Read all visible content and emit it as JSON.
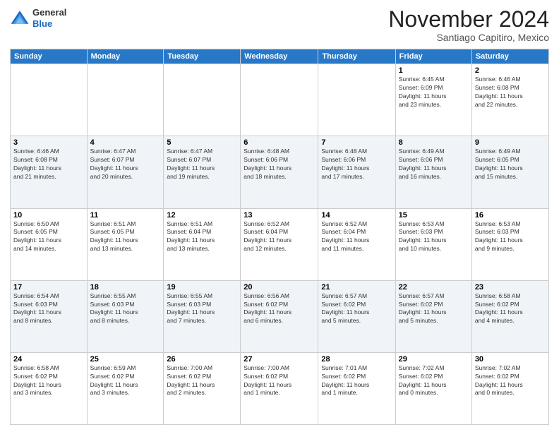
{
  "header": {
    "logo": {
      "line1": "General",
      "line2": "Blue"
    },
    "title": "November 2024",
    "location": "Santiago Capitiro, Mexico"
  },
  "days_of_week": [
    "Sunday",
    "Monday",
    "Tuesday",
    "Wednesday",
    "Thursday",
    "Friday",
    "Saturday"
  ],
  "weeks": [
    [
      {
        "day": "",
        "info": ""
      },
      {
        "day": "",
        "info": ""
      },
      {
        "day": "",
        "info": ""
      },
      {
        "day": "",
        "info": ""
      },
      {
        "day": "",
        "info": ""
      },
      {
        "day": "1",
        "info": "Sunrise: 6:45 AM\nSunset: 6:09 PM\nDaylight: 11 hours\nand 23 minutes."
      },
      {
        "day": "2",
        "info": "Sunrise: 6:46 AM\nSunset: 6:08 PM\nDaylight: 11 hours\nand 22 minutes."
      }
    ],
    [
      {
        "day": "3",
        "info": "Sunrise: 6:46 AM\nSunset: 6:08 PM\nDaylight: 11 hours\nand 21 minutes."
      },
      {
        "day": "4",
        "info": "Sunrise: 6:47 AM\nSunset: 6:07 PM\nDaylight: 11 hours\nand 20 minutes."
      },
      {
        "day": "5",
        "info": "Sunrise: 6:47 AM\nSunset: 6:07 PM\nDaylight: 11 hours\nand 19 minutes."
      },
      {
        "day": "6",
        "info": "Sunrise: 6:48 AM\nSunset: 6:06 PM\nDaylight: 11 hours\nand 18 minutes."
      },
      {
        "day": "7",
        "info": "Sunrise: 6:48 AM\nSunset: 6:06 PM\nDaylight: 11 hours\nand 17 minutes."
      },
      {
        "day": "8",
        "info": "Sunrise: 6:49 AM\nSunset: 6:06 PM\nDaylight: 11 hours\nand 16 minutes."
      },
      {
        "day": "9",
        "info": "Sunrise: 6:49 AM\nSunset: 6:05 PM\nDaylight: 11 hours\nand 15 minutes."
      }
    ],
    [
      {
        "day": "10",
        "info": "Sunrise: 6:50 AM\nSunset: 6:05 PM\nDaylight: 11 hours\nand 14 minutes."
      },
      {
        "day": "11",
        "info": "Sunrise: 6:51 AM\nSunset: 6:05 PM\nDaylight: 11 hours\nand 13 minutes."
      },
      {
        "day": "12",
        "info": "Sunrise: 6:51 AM\nSunset: 6:04 PM\nDaylight: 11 hours\nand 13 minutes."
      },
      {
        "day": "13",
        "info": "Sunrise: 6:52 AM\nSunset: 6:04 PM\nDaylight: 11 hours\nand 12 minutes."
      },
      {
        "day": "14",
        "info": "Sunrise: 6:52 AM\nSunset: 6:04 PM\nDaylight: 11 hours\nand 11 minutes."
      },
      {
        "day": "15",
        "info": "Sunrise: 6:53 AM\nSunset: 6:03 PM\nDaylight: 11 hours\nand 10 minutes."
      },
      {
        "day": "16",
        "info": "Sunrise: 6:53 AM\nSunset: 6:03 PM\nDaylight: 11 hours\nand 9 minutes."
      }
    ],
    [
      {
        "day": "17",
        "info": "Sunrise: 6:54 AM\nSunset: 6:03 PM\nDaylight: 11 hours\nand 8 minutes."
      },
      {
        "day": "18",
        "info": "Sunrise: 6:55 AM\nSunset: 6:03 PM\nDaylight: 11 hours\nand 8 minutes."
      },
      {
        "day": "19",
        "info": "Sunrise: 6:55 AM\nSunset: 6:03 PM\nDaylight: 11 hours\nand 7 minutes."
      },
      {
        "day": "20",
        "info": "Sunrise: 6:56 AM\nSunset: 6:02 PM\nDaylight: 11 hours\nand 6 minutes."
      },
      {
        "day": "21",
        "info": "Sunrise: 6:57 AM\nSunset: 6:02 PM\nDaylight: 11 hours\nand 5 minutes."
      },
      {
        "day": "22",
        "info": "Sunrise: 6:57 AM\nSunset: 6:02 PM\nDaylight: 11 hours\nand 5 minutes."
      },
      {
        "day": "23",
        "info": "Sunrise: 6:58 AM\nSunset: 6:02 PM\nDaylight: 11 hours\nand 4 minutes."
      }
    ],
    [
      {
        "day": "24",
        "info": "Sunrise: 6:58 AM\nSunset: 6:02 PM\nDaylight: 11 hours\nand 3 minutes."
      },
      {
        "day": "25",
        "info": "Sunrise: 6:59 AM\nSunset: 6:02 PM\nDaylight: 11 hours\nand 3 minutes."
      },
      {
        "day": "26",
        "info": "Sunrise: 7:00 AM\nSunset: 6:02 PM\nDaylight: 11 hours\nand 2 minutes."
      },
      {
        "day": "27",
        "info": "Sunrise: 7:00 AM\nSunset: 6:02 PM\nDaylight: 11 hours\nand 1 minute."
      },
      {
        "day": "28",
        "info": "Sunrise: 7:01 AM\nSunset: 6:02 PM\nDaylight: 11 hours\nand 1 minute."
      },
      {
        "day": "29",
        "info": "Sunrise: 7:02 AM\nSunset: 6:02 PM\nDaylight: 11 hours\nand 0 minutes."
      },
      {
        "day": "30",
        "info": "Sunrise: 7:02 AM\nSunset: 6:02 PM\nDaylight: 11 hours\nand 0 minutes."
      }
    ]
  ]
}
